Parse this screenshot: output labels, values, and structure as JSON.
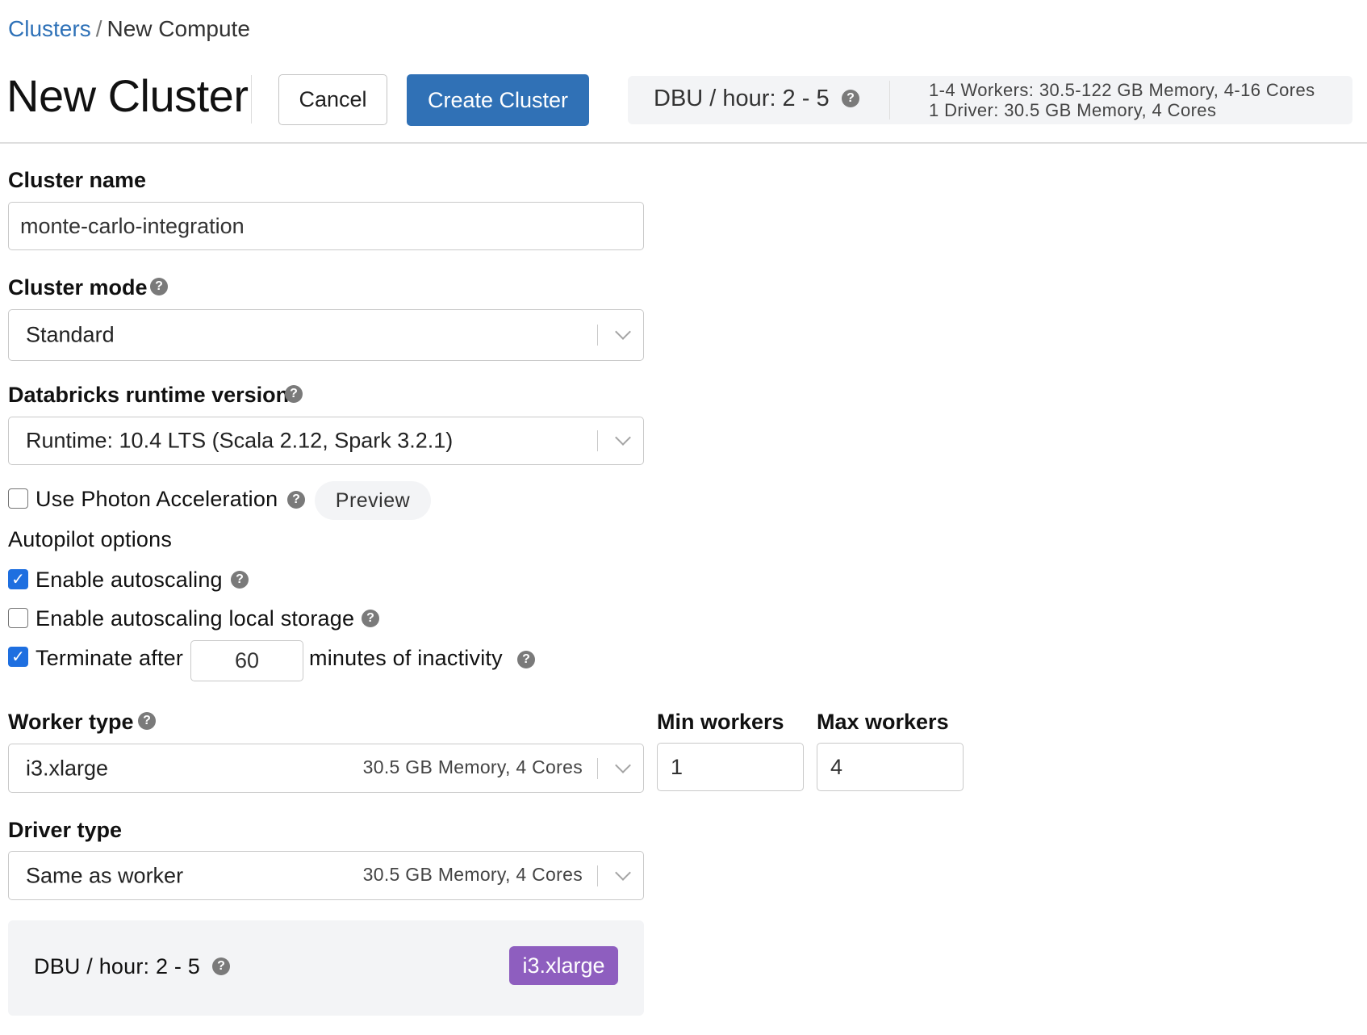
{
  "breadcrumb": {
    "root": "Clusters",
    "separator": "/",
    "current": "New Compute"
  },
  "header": {
    "title": "New Cluster",
    "cancel_label": "Cancel",
    "create_label": "Create Cluster",
    "summary": {
      "dbu": "DBU / hour: 2 - 5",
      "workers_spec": "1-4 Workers: 30.5-122 GB Memory, 4-16 Cores",
      "driver_spec": "1 Driver: 30.5 GB Memory, 4 Cores"
    }
  },
  "form": {
    "cluster_name": {
      "label": "Cluster name",
      "value": "monte-carlo-integration"
    },
    "cluster_mode": {
      "label": "Cluster mode",
      "value": "Standard"
    },
    "runtime": {
      "label": "Databricks runtime version",
      "value": "Runtime: 10.4 LTS (Scala 2.12, Spark 3.2.1)"
    },
    "photon": {
      "label": "Use Photon Acceleration",
      "checked": false,
      "badge": "Preview"
    },
    "autopilot": {
      "heading": "Autopilot options",
      "autoscaling": {
        "label": "Enable autoscaling",
        "checked": true
      },
      "local_storage": {
        "label": "Enable autoscaling local storage",
        "checked": false
      },
      "terminate": {
        "label_before": "Terminate after",
        "minutes": "60",
        "label_after": "minutes of inactivity",
        "checked": true
      }
    },
    "worker_type": {
      "label": "Worker type",
      "value": "i3.xlarge",
      "spec": "30.5 GB Memory, 4 Cores"
    },
    "min_workers": {
      "label": "Min workers",
      "value": "1"
    },
    "max_workers": {
      "label": "Max workers",
      "value": "4"
    },
    "driver_type": {
      "label": "Driver type",
      "value": "Same as worker",
      "spec": "30.5 GB Memory, 4 Cores"
    },
    "cost": {
      "dbu": "DBU / hour: 2 - 5",
      "instance_badge": "i3.xlarge"
    }
  },
  "icons": {
    "help": "?",
    "check": "✓"
  },
  "colors": {
    "primary": "#3071b6",
    "link": "#2f72b8",
    "checkbox": "#1e6fe0",
    "badge": "#8e5ebf",
    "panel": "#f3f4f6"
  }
}
